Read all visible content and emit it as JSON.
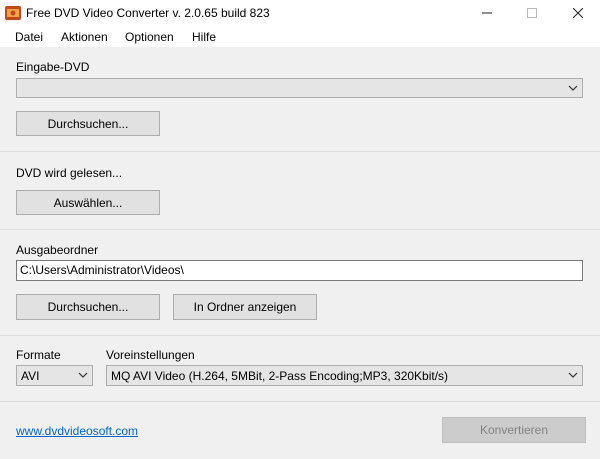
{
  "window": {
    "title": "Free DVD Video Converter  v. 2.0.65 build 823",
    "minimize_icon": "minimize-icon",
    "maximize_icon": "maximize-icon",
    "close_icon": "close-icon"
  },
  "menu": [
    "Datei",
    "Aktionen",
    "Optionen",
    "Hilfe"
  ],
  "input_dvd": {
    "label": "Eingabe-DVD",
    "selected_value": "",
    "browse_label": "Durchsuchen..."
  },
  "reading": {
    "status": "DVD wird gelesen...",
    "select_label": "Auswählen..."
  },
  "output": {
    "label": "Ausgabeordner",
    "path": "C:\\Users\\Administrator\\Videos\\",
    "browse_label": "Durchsuchen...",
    "show_folder_label": "In Ordner anzeigen"
  },
  "format": {
    "label": "Formate",
    "selected": "AVI"
  },
  "preset": {
    "label": "Voreinstellungen",
    "selected": "MQ AVI Video (H.264, 5MBit, 2-Pass Encoding;MP3, 320Kbit/s)"
  },
  "footer": {
    "link": "www.dvdvideosoft.com",
    "convert_label": "Konvertieren"
  },
  "colors": {
    "link": "#0066cc",
    "background": "#f0f0f0",
    "button": "#e1e1e1",
    "disabled_button": "#cccccc"
  }
}
